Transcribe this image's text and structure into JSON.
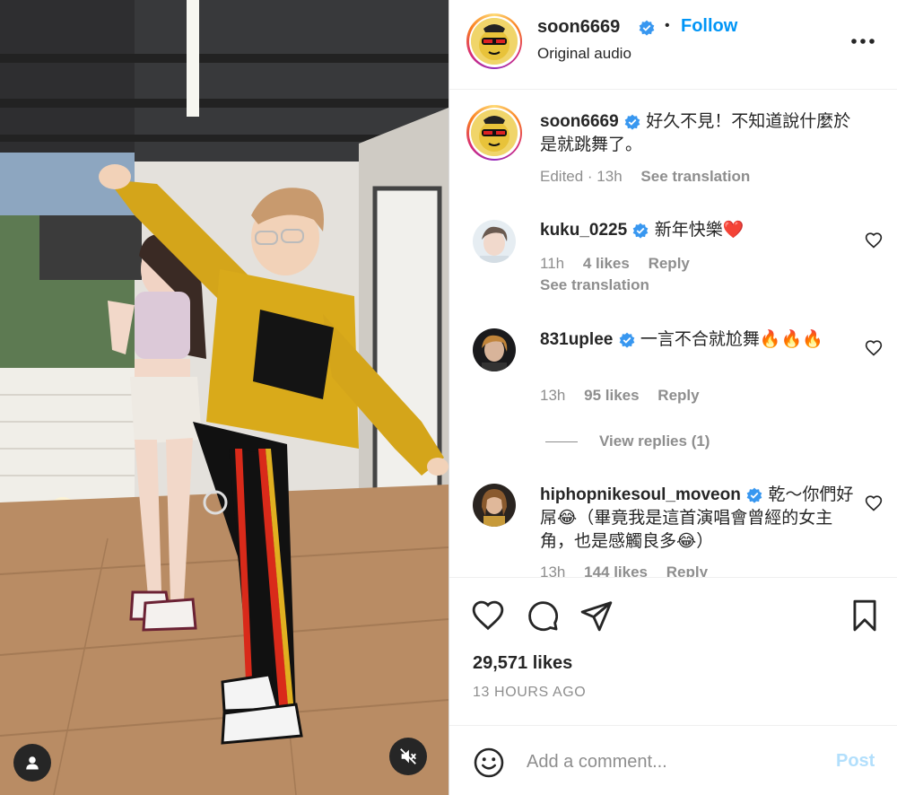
{
  "post": {
    "author": "soon6669",
    "follow_label": "Follow",
    "separator": "•",
    "audio_label": "Original audio",
    "caption": {
      "username": "soon6669",
      "text": "好久不見！不知道說什麼於是就跳舞了。",
      "edited": "Edited · 13h",
      "see_translation": "See translation"
    },
    "likes_text": "29,571 likes",
    "time_ago": "13 HOURS AGO"
  },
  "comments": [
    {
      "username": "kuku_0225",
      "text": "新年快樂❤️",
      "time": "11h",
      "likes": "4 likes",
      "reply_label": "Reply",
      "see_translation": "See translation"
    },
    {
      "username": "831uplee",
      "text": "一言不合就尬舞🔥🔥🔥",
      "time": "13h",
      "likes": "95 likes",
      "reply_label": "Reply",
      "view_replies": "View replies (1)"
    },
    {
      "username": "hiphopnikesoul_moveon",
      "text": "乾～你們好屌😂（畢竟我是這首演唱會曾經的女主角，也是感觸良多😂）",
      "time": "13h",
      "likes": "144 likes",
      "reply_label": "Reply"
    }
  ],
  "composer": {
    "placeholder": "Add a comment...",
    "post_label": "Post"
  },
  "colors": {
    "link_blue": "#0095f6",
    "post_disabled": "#b2dffc",
    "secondary_text": "#8e8e8e",
    "primary_text": "#262626"
  },
  "icons": {
    "header_more": "more-horizontal-icon",
    "verified": "verified-badge-icon",
    "like": "heart-outline-icon",
    "comment": "comment-bubble-icon",
    "share": "paper-plane-icon",
    "save": "bookmark-icon",
    "emoji": "smiley-icon",
    "tags": "user-tag-icon",
    "mute": "muted-speaker-icon"
  }
}
